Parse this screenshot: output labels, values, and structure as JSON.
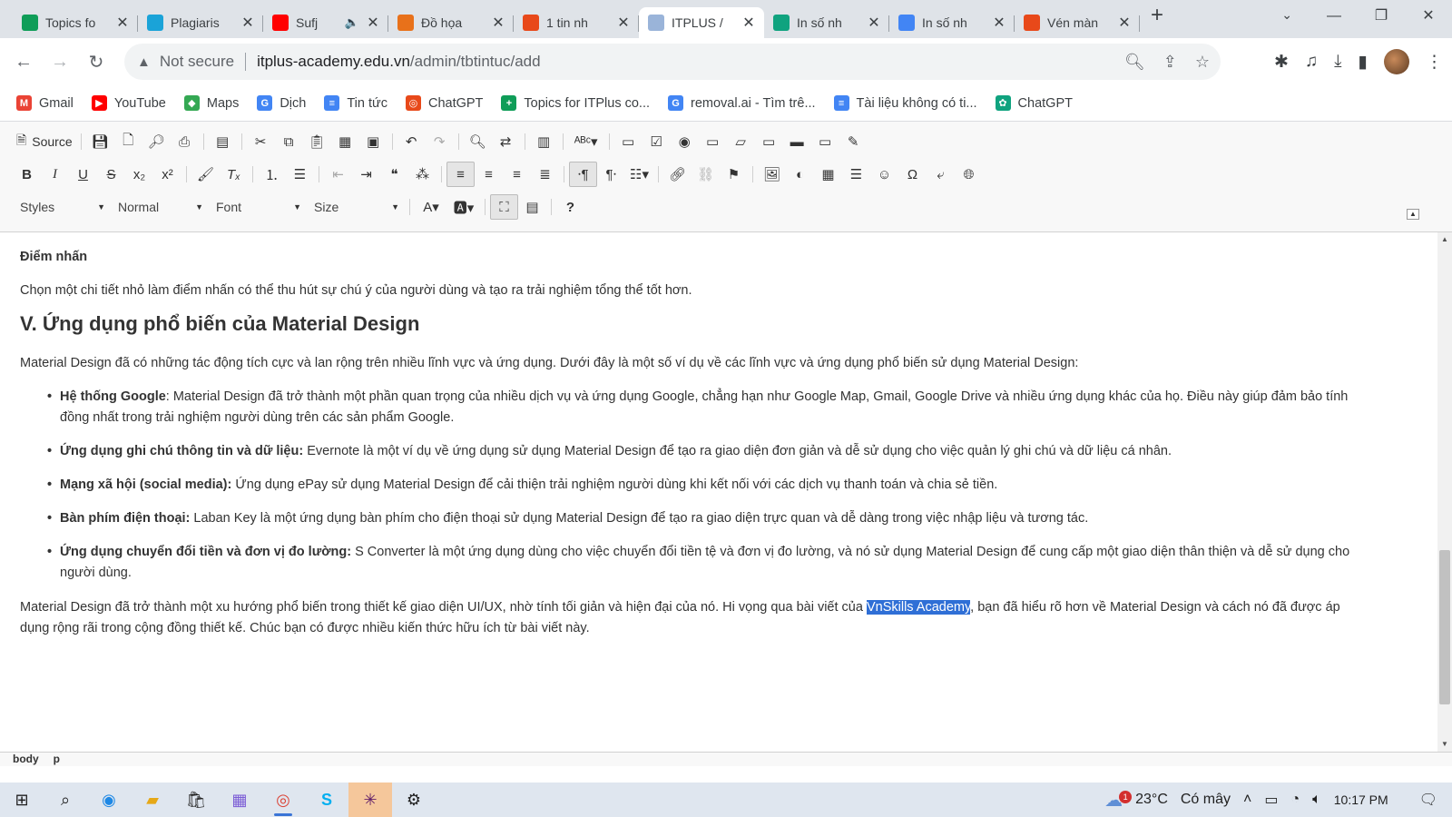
{
  "tabs": [
    {
      "title": "Topics fo",
      "icon": "green-sheet-icon",
      "color": "#0f9d58"
    },
    {
      "title": "Plagiaris",
      "icon": "c-logo-icon",
      "color": "#1aa3d8"
    },
    {
      "title": "Sufj",
      "icon": "youtube-icon",
      "color": "#ff0000",
      "muted": "🔈"
    },
    {
      "title": "Đồ họa",
      "icon": "site-icon",
      "color": "#e8711a"
    },
    {
      "title": "1 tin nh",
      "icon": "diamond-icon",
      "color": "#e8491a"
    },
    {
      "title": "ITPLUS /",
      "icon": "itplus-icon",
      "color": "#9ab4d9",
      "active": true
    },
    {
      "title": "In số nh",
      "icon": "chatgpt-icon",
      "color": "#10a37f"
    },
    {
      "title": "In số nh",
      "icon": "docs-icon",
      "color": "#4285f4"
    },
    {
      "title": "Vén màn",
      "icon": "diamond-icon",
      "color": "#e8491a"
    }
  ],
  "nav": {
    "not_secure": "Not secure",
    "url_host": "itplus-academy.edu.vn",
    "url_path": "/admin/tbtintuc/add"
  },
  "bookmarks": [
    {
      "label": "Gmail",
      "icon": "gmail-icon",
      "color": "#ea4335",
      "glyph": "M"
    },
    {
      "label": "YouTube",
      "icon": "youtube-icon",
      "color": "#ff0000",
      "glyph": "▶"
    },
    {
      "label": "Maps",
      "icon": "maps-pin-icon",
      "color": "#34a853",
      "glyph": "◆"
    },
    {
      "label": "Dịch",
      "icon": "translate-icon",
      "color": "#4285f4",
      "glyph": "G"
    },
    {
      "label": "Tin tức",
      "icon": "news-icon",
      "color": "#4285f4",
      "glyph": "≡"
    },
    {
      "label": "ChatGPT",
      "icon": "target-icon",
      "color": "#e8491a",
      "glyph": "◎"
    },
    {
      "label": "Topics for ITPlus co...",
      "icon": "green-sheet-icon",
      "color": "#0f9d58",
      "glyph": "+"
    },
    {
      "label": "removal.ai - Tìm trê...",
      "icon": "google-icon",
      "color": "#4285f4",
      "glyph": "G"
    },
    {
      "label": "Tài liệu không có ti...",
      "icon": "docs-icon",
      "color": "#4285f4",
      "glyph": "≡"
    },
    {
      "label": "ChatGPT",
      "icon": "chatgpt-icon",
      "color": "#10a37f",
      "glyph": "✿"
    }
  ],
  "editor": {
    "source_label": "Source",
    "combos": {
      "styles": "Styles",
      "format": "Normal",
      "font": "Font",
      "size": "Size"
    },
    "path": [
      "body",
      "p"
    ]
  },
  "content": {
    "heading_small": "Điểm nhấn",
    "para1": "Chọn một chi tiết nhỏ làm điểm nhấn có thể thu hút sự chú ý của người dùng và tạo ra trải nghiệm tổng thể tốt hơn.",
    "h2": "V. Ứng dụng phổ biến của Material Design",
    "para2": "Material Design đã có những tác động tích cực và lan rộng trên nhiều lĩnh vực và ứng dụng. Dưới đây là một số ví dụ về các lĩnh vực và ứng dụng phổ biến sử dụng Material Design:",
    "list": [
      {
        "bold": "Hệ thống Google",
        "text": ": Material Design đã trở thành một phần quan trọng của nhiều dịch vụ và ứng dụng Google, chẳng hạn như Google Map, Gmail, Google Drive và nhiều ứng dụng khác của họ. Điều này giúp đảm bảo tính đồng nhất trong trải nghiệm người dùng trên các sản phẩm Google."
      },
      {
        "bold": "Ứng dụng ghi chú thông tin và dữ liệu:",
        "text": " Evernote là một ví dụ về ứng dụng sử dụng Material Design để tạo ra giao diện đơn giản và dễ sử dụng cho việc quản lý ghi chú và dữ liệu cá nhân."
      },
      {
        "bold": "Mạng xã hội (social media):",
        "text": " Ứng dụng ePay sử dụng Material Design để cải thiện trải nghiệm người dùng khi kết nối với các dịch vụ thanh toán và chia sẻ tiền."
      },
      {
        "bold": "Bàn phím điện thoại:",
        "text": " Laban Key là một ứng dụng bàn phím cho điện thoại sử dụng Material Design để tạo ra giao diện trực quan và dễ dàng trong việc nhập liệu và tương tác."
      },
      {
        "bold": "Ứng dụng chuyển đổi tiền và đơn vị đo lường:",
        "text": " S Converter là một ứng dụng dùng cho việc chuyển đổi tiền tệ và đơn vị đo lường, và nó sử dụng Material Design để cung cấp một giao diện thân thiện và dễ sử dụng cho người dùng."
      }
    ],
    "para3_before": "Material Design đã trở thành một xu hướng phổ biến trong thiết kế giao diện UI/UX, nhờ tính tối giản và hiện đại của nó. Hi vọng qua bài viết của ",
    "para3_selected": "VnSkills Academy",
    "para3_after": ", bạn đã hiểu rõ hơn về Material Design và cách nó đã được áp dụng rộng rãi trong cộng đồng thiết kế. Chúc bạn có được nhiều kiến thức hữu ích từ bài viết này."
  },
  "taskbar": {
    "temperature": "23°C",
    "weather": "Có mây",
    "weather_badge": "1",
    "time": "10:17 PM"
  }
}
